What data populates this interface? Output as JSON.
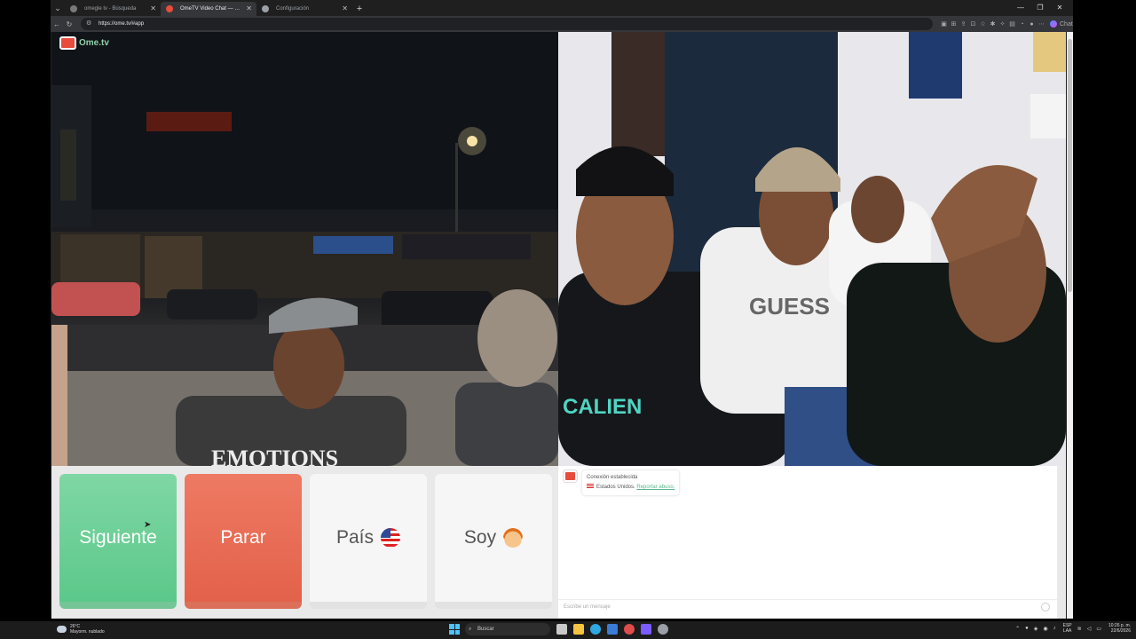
{
  "browser": {
    "tabs": [
      {
        "label": "omegle tv - Búsqueda",
        "active": false
      },
      {
        "label": "OmeTV Video Chat — Omegle",
        "active": true
      },
      {
        "label": "Configuración",
        "active": false
      }
    ],
    "url": "https://ome.tv/#app",
    "chat_button": "Chat"
  },
  "page": {
    "logo_text": "Ome.tv",
    "buttons": {
      "next": "Siguiente",
      "stop": "Parar",
      "country": "País",
      "me": "Soy"
    },
    "chat": {
      "status": "Conexión establecida",
      "country": "Estados Unidos.",
      "report_link": "Reportar abuso.",
      "input_placeholder": "Escribe un mensaje"
    }
  },
  "taskbar": {
    "weather_temp": "26°C",
    "weather_desc": "Mayorm. nublado",
    "search_placeholder": "Buscar",
    "language_top": "ESP",
    "language_bottom": "LAA",
    "time": "10:26 p. m.",
    "date": "22/6/2026"
  },
  "colors": {
    "next_button": "#6fd09a",
    "stop_button": "#e86d55",
    "brand_green": "#8fd1a9",
    "brand_red": "#e74c3c"
  }
}
